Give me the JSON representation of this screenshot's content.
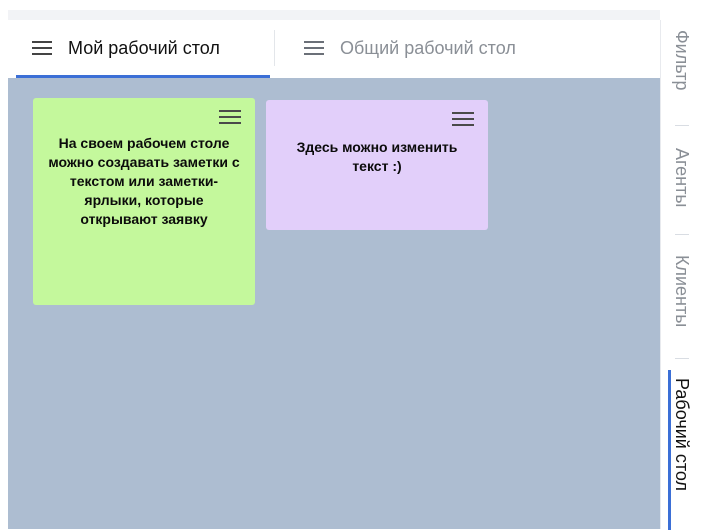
{
  "tabs": {
    "my_desk": "Мой рабочий стол",
    "shared_desk": "Общий рабочий стол",
    "menu_icon": "hamburger-menu-icon"
  },
  "notes": [
    {
      "text": "На своем рабочем столе можно создавать заметки с текстом или заметки-ярлыки, которые открывают заявку",
      "color": "#c4f89c"
    },
    {
      "text": "Здесь можно изменить текст :)",
      "color": "#e2cffa"
    }
  ],
  "sidebar": {
    "items": [
      "Фильтр",
      "Агенты",
      "Клиенты",
      "Рабочий стол"
    ],
    "active": "Рабочий стол"
  },
  "colors": {
    "accent": "#3b6fd6",
    "board_background": "#adbdd1"
  }
}
